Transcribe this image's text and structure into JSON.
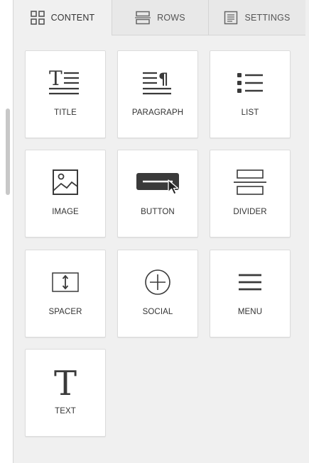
{
  "tabs": [
    {
      "label": "CONTENT",
      "icon": "grid-icon",
      "active": true
    },
    {
      "label": "ROWS",
      "icon": "rows-icon",
      "active": false
    },
    {
      "label": "SETTINGS",
      "icon": "settings-icon",
      "active": false
    }
  ],
  "blocks": [
    {
      "label": "TITLE",
      "icon": "title-icon"
    },
    {
      "label": "PARAGRAPH",
      "icon": "paragraph-icon"
    },
    {
      "label": "LIST",
      "icon": "list-icon"
    },
    {
      "label": "IMAGE",
      "icon": "image-icon"
    },
    {
      "label": "BUTTON",
      "icon": "button-icon"
    },
    {
      "label": "DIVIDER",
      "icon": "divider-icon"
    },
    {
      "label": "SPACER",
      "icon": "spacer-icon"
    },
    {
      "label": "SOCIAL",
      "icon": "social-icon"
    },
    {
      "label": "MENU",
      "icon": "menu-icon"
    },
    {
      "label": "TEXT",
      "icon": "text-icon"
    }
  ],
  "colors": {
    "panel_bg": "#f0f0f0",
    "tile_bg": "#ffffff",
    "icon": "#3a3a3a",
    "tab_inactive_bg": "#e8e8e8"
  }
}
